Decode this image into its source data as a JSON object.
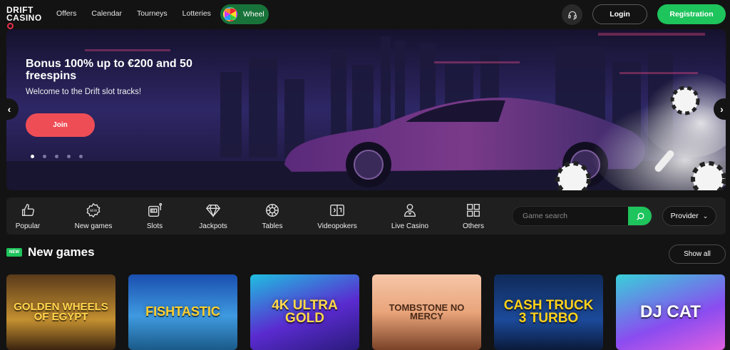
{
  "brand": {
    "line1": "DRIFT",
    "line2": "CASINO"
  },
  "nav": [
    "Offers",
    "Calendar",
    "Tourneys",
    "Lotteries"
  ],
  "wheel": {
    "label": "Wheel"
  },
  "header": {
    "login": "Login",
    "register": "Registration"
  },
  "hero": {
    "title": "Bonus 100% up to €200 and 50 freespins",
    "subtitle": "Welcome to the Drift slot tracks!",
    "cta": "Join",
    "slides": 5,
    "active_slide": 1
  },
  "categories": [
    {
      "label": "Popular",
      "icon": "thumbs-up-icon"
    },
    {
      "label": "New games",
      "icon": "new-badge-icon"
    },
    {
      "label": "Slots",
      "icon": "slot-machine-icon"
    },
    {
      "label": "Jackpots",
      "icon": "diamond-icon"
    },
    {
      "label": "Tables",
      "icon": "roulette-icon"
    },
    {
      "label": "Videopokers",
      "icon": "cards-icon"
    },
    {
      "label": "Live Casino",
      "icon": "dealer-icon"
    },
    {
      "label": "Others",
      "icon": "grid-icon"
    }
  ],
  "search": {
    "placeholder": "Game search"
  },
  "provider": {
    "label": "Provider"
  },
  "section": {
    "badge": "NEW",
    "title": "New games",
    "show_all": "Show all"
  },
  "games": [
    {
      "title": "GOLDEN WHEELS OF EGYPT"
    },
    {
      "title": "FISHTASTIC"
    },
    {
      "title": "4K ULTRA GOLD"
    },
    {
      "title": "TOMBSTONE NO MERCY"
    },
    {
      "title": "CASH TRUCK 3 TURBO"
    },
    {
      "title": "DJ CAT"
    }
  ],
  "colors": {
    "accent_green": "#1ec45c",
    "join_red": "#ef4d56",
    "background": "#131313"
  }
}
